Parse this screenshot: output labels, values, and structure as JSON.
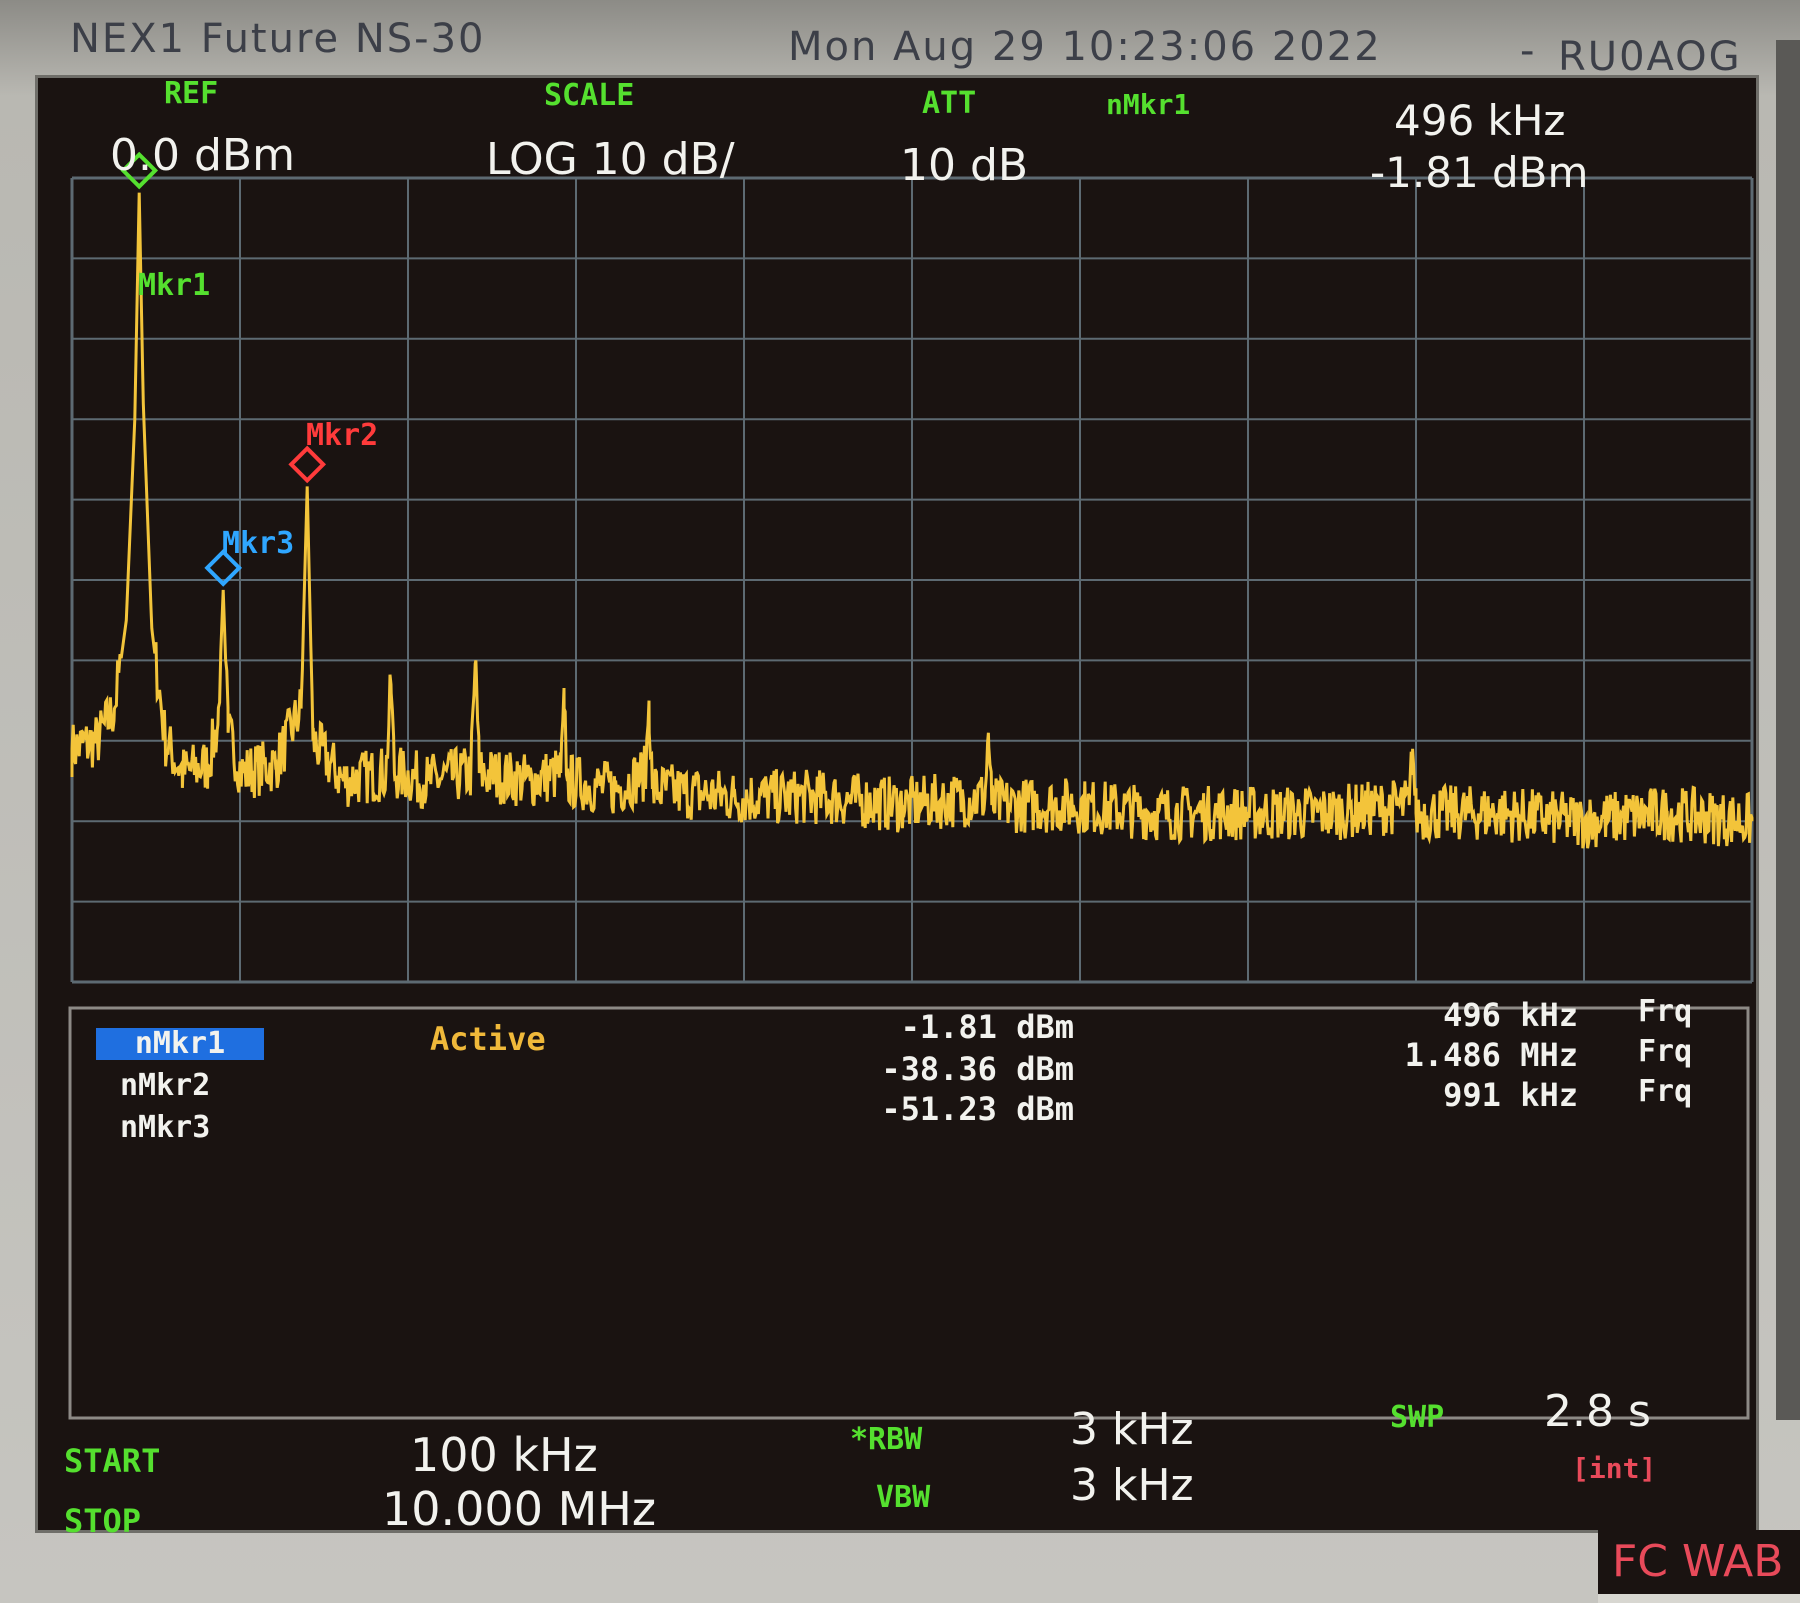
{
  "window": {
    "app_title": "NEX1 Future NS-30",
    "datetime": "Mon Aug 29 10:23:06 2022",
    "separator": "-",
    "callsign": "RU0AOG"
  },
  "header": {
    "ref_label": "REF",
    "ref_value": "0.0 dBm",
    "scale_label": "SCALE",
    "scale_value": "LOG 10 dB/",
    "att_label": "ATT",
    "att_value": "10 dB",
    "active_marker_label": "nMkr1",
    "active_marker_freq": "496 kHz",
    "active_marker_level": "-1.81 dBm"
  },
  "markers_on_trace": [
    {
      "label": "Mkr1",
      "color": "#55e02f"
    },
    {
      "label": "Mkr2",
      "color": "#ff3b3b"
    },
    {
      "label": "Mkr3",
      "color": "#2fa6ff"
    }
  ],
  "marker_table": {
    "status": "Active",
    "rows": [
      {
        "name": "nMkr1",
        "level": "-1.81 dBm",
        "freq": "496 kHz",
        "type": "Frq",
        "selected": true
      },
      {
        "name": "nMkr2",
        "level": "-38.36 dBm",
        "freq": "1.486 MHz",
        "type": "Frq",
        "selected": false
      },
      {
        "name": "nMkr3",
        "level": "-51.23 dBm",
        "freq": "991 kHz",
        "type": "Frq",
        "selected": false
      }
    ]
  },
  "footer": {
    "start_label": "START",
    "start_value": "100 kHz",
    "stop_label": "STOP",
    "stop_value": "10.000 MHz",
    "rbw_label": "*RBW",
    "rbw_value": "3 kHz",
    "vbw_label": "VBW",
    "vbw_value": "3 kHz",
    "swp_label": "SWP",
    "swp_value": "2.8 s",
    "swp_mode": "[int]",
    "badge": "FC WAB"
  },
  "colors": {
    "trace": "#f3c43a",
    "grid": "#5d6a72",
    "label_green": "#55e02f",
    "marker_red": "#ff3b3b",
    "marker_blue": "#2fa6ff",
    "text_white": "#f2f2ee",
    "active_yellow": "#f0b93a",
    "selected_bg": "#1f6fe0",
    "badge_red": "#e84a5a"
  },
  "chart_data": {
    "type": "line",
    "xlim": [
      0.1,
      10.0
    ],
    "ylim": [
      -100,
      0
    ],
    "grid": true,
    "series": [
      {
        "x": [
          0.1,
          0.25,
          0.35,
          0.42,
          0.47,
          0.496,
          0.52,
          0.57,
          0.65,
          0.75,
          0.9,
          0.96,
          0.991,
          1.02,
          1.1,
          1.3,
          1.45,
          1.486,
          1.52,
          1.7,
          1.95,
          1.98,
          2.0,
          2.2,
          2.45,
          2.48,
          2.5,
          2.8,
          2.98,
          3.0,
          3.02,
          3.3,
          3.48,
          3.5,
          3.52,
          4.0,
          4.5,
          5.0,
          5.48,
          5.5,
          5.52,
          6.0,
          6.5,
          7.0,
          7.5,
          7.98,
          8.0,
          8.02,
          8.5,
          9.0,
          9.5,
          10.0
        ],
        "y": [
          -71,
          -70,
          -66,
          -55,
          -30,
          -1.81,
          -28,
          -56,
          -70,
          -74,
          -73,
          -68,
          -51.23,
          -69,
          -74,
          -73,
          -66,
          -38.36,
          -70,
          -75,
          -74,
          -63,
          -74,
          -75,
          -74,
          -60,
          -74,
          -75,
          -74,
          -66,
          -75,
          -76,
          -74,
          -65,
          -76,
          -77,
          -77,
          -78,
          -77,
          -69,
          -78,
          -78,
          -79,
          -79,
          -79,
          -78,
          -71,
          -79,
          -79,
          -80,
          -79,
          -80
        ]
      }
    ],
    "markers": [
      {
        "name": "Mkr1",
        "x": 0.496,
        "y": -1.81
      },
      {
        "name": "Mkr2",
        "x": 1.486,
        "y": -38.36
      },
      {
        "name": "Mkr3",
        "x": 0.991,
        "y": -51.23
      }
    ]
  }
}
